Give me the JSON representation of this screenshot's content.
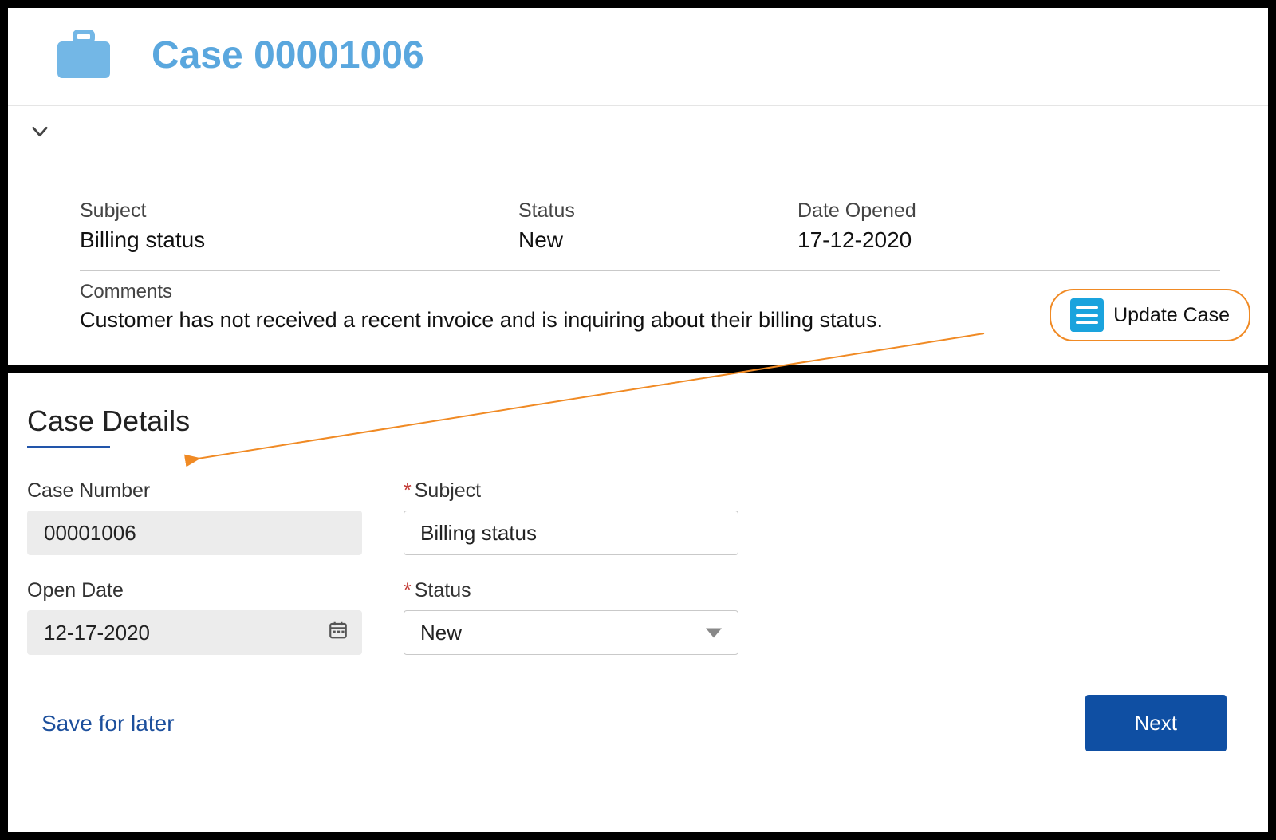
{
  "header": {
    "title": "Case 00001006"
  },
  "summary": {
    "subject_label": "Subject",
    "subject_value": "Billing status",
    "status_label": "Status",
    "status_value": "New",
    "date_opened_label": "Date Opened",
    "date_opened_value": "17-12-2020",
    "comments_label": "Comments",
    "comments_value": "Customer has not received a recent invoice and is inquiring about their billing status."
  },
  "actions": {
    "update_case_label": "Update Case"
  },
  "details": {
    "section_title": "Case Details",
    "case_number_label": "Case Number",
    "case_number_value": "00001006",
    "subject_label": "Subject",
    "subject_value": "Billing status",
    "open_date_label": "Open Date",
    "open_date_value": "12-17-2020",
    "status_label": "Status",
    "status_value": "New"
  },
  "footer": {
    "save_later_label": "Save for later",
    "next_label": "Next"
  }
}
